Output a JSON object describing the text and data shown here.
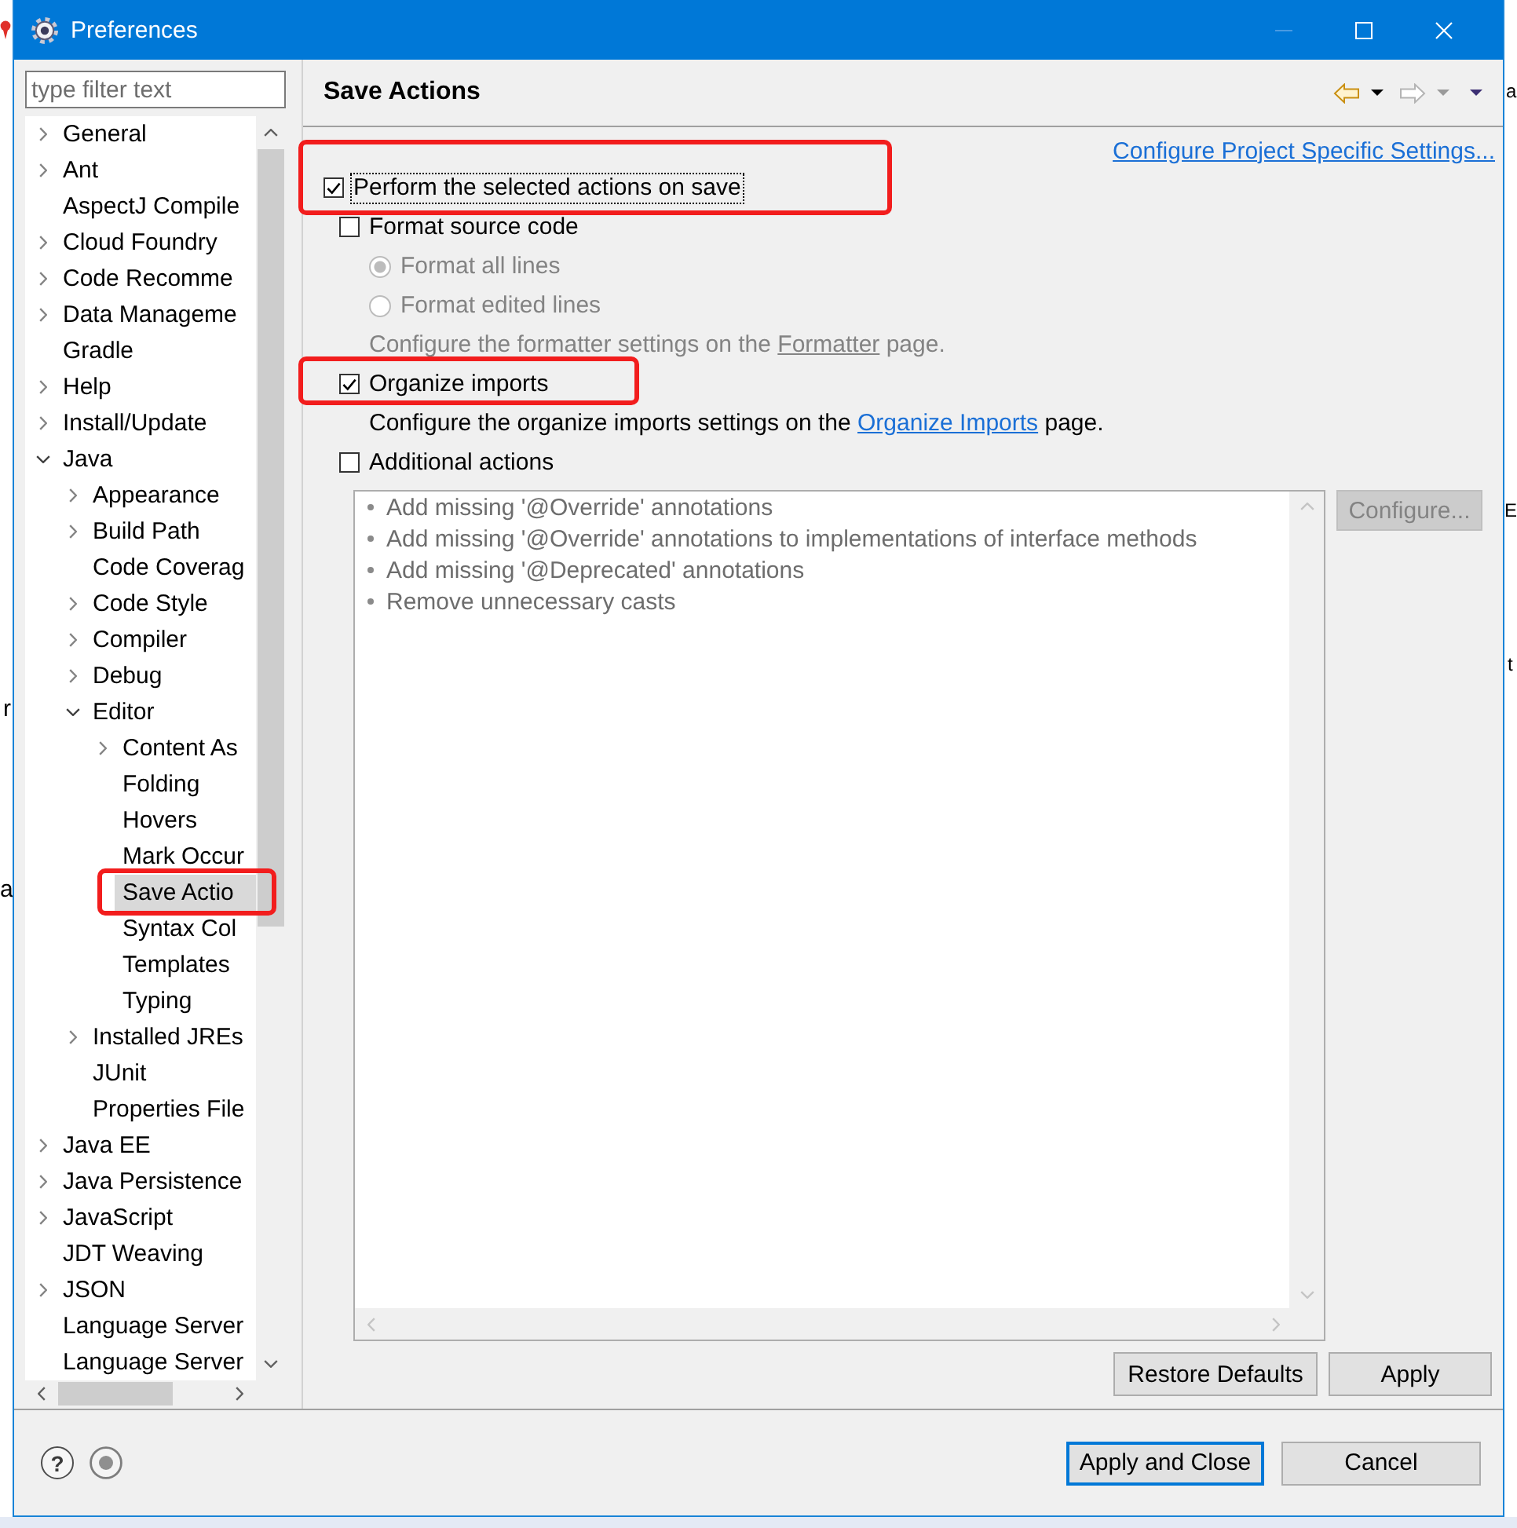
{
  "window": {
    "title": "Preferences",
    "controls": [
      {
        "kind": "minimize",
        "disabled": true
      },
      {
        "kind": "maximize",
        "disabled": false
      },
      {
        "kind": "close",
        "disabled": false
      }
    ]
  },
  "background_window": {
    "left_edge_texts": [
      "r",
      "a"
    ],
    "right_edge_texts": [
      "a",
      "E",
      "t"
    ]
  },
  "filter": {
    "placeholder": "type filter text"
  },
  "tree": [
    {
      "label": "General",
      "kind": "branch",
      "expanded": false,
      "selected": false
    },
    {
      "label": "Ant",
      "kind": "branch",
      "expanded": false,
      "selected": false
    },
    {
      "label": "AspectJ Compile",
      "kind": "leaf",
      "selected": false
    },
    {
      "label": "Cloud Foundry",
      "kind": "branch",
      "expanded": false,
      "selected": false
    },
    {
      "label": "Code Recomme",
      "kind": "branch",
      "expanded": false,
      "selected": false
    },
    {
      "label": "Data Manageme",
      "kind": "branch",
      "expanded": false,
      "selected": false
    },
    {
      "label": "Gradle",
      "kind": "leaf",
      "selected": false
    },
    {
      "label": "Help",
      "kind": "branch",
      "expanded": false,
      "selected": false
    },
    {
      "label": "Install/Update",
      "kind": "branch",
      "expanded": false,
      "selected": false
    },
    {
      "label": "Java",
      "kind": "branch",
      "expanded": true,
      "selected": false,
      "children": [
        {
          "label": "Appearance",
          "kind": "branch",
          "expanded": false,
          "selected": false
        },
        {
          "label": "Build Path",
          "kind": "branch",
          "expanded": false,
          "selected": false
        },
        {
          "label": "Code Coverag",
          "kind": "leaf",
          "selected": false
        },
        {
          "label": "Code Style",
          "kind": "branch",
          "expanded": false,
          "selected": false
        },
        {
          "label": "Compiler",
          "kind": "branch",
          "expanded": false,
          "selected": false
        },
        {
          "label": "Debug",
          "kind": "branch",
          "expanded": false,
          "selected": false
        },
        {
          "label": "Editor",
          "kind": "branch",
          "expanded": true,
          "selected": false,
          "children": [
            {
              "label": "Content As",
              "kind": "branch",
              "expanded": false,
              "selected": false
            },
            {
              "label": "Folding",
              "kind": "leaf",
              "selected": false
            },
            {
              "label": "Hovers",
              "kind": "leaf",
              "selected": false
            },
            {
              "label": "Mark Occur",
              "kind": "leaf",
              "selected": false
            },
            {
              "label": "Save Actio",
              "kind": "leaf",
              "selected": true,
              "highlighted": true
            },
            {
              "label": "Syntax Col",
              "kind": "leaf",
              "selected": false
            },
            {
              "label": "Templates",
              "kind": "leaf",
              "selected": false
            },
            {
              "label": "Typing",
              "kind": "leaf",
              "selected": false
            }
          ]
        },
        {
          "label": "Installed JREs",
          "kind": "branch",
          "expanded": false,
          "selected": false
        },
        {
          "label": "JUnit",
          "kind": "leaf",
          "selected": false
        },
        {
          "label": "Properties File",
          "kind": "leaf",
          "selected": false
        }
      ]
    },
    {
      "label": "Java EE",
      "kind": "branch",
      "expanded": false,
      "selected": false
    },
    {
      "label": "Java Persistence",
      "kind": "branch",
      "expanded": false,
      "selected": false
    },
    {
      "label": "JavaScript",
      "kind": "branch",
      "expanded": false,
      "selected": false
    },
    {
      "label": "JDT Weaving",
      "kind": "leaf",
      "selected": false
    },
    {
      "label": "JSON",
      "kind": "branch",
      "expanded": false,
      "selected": false
    },
    {
      "label": "Language Server",
      "kind": "leaf",
      "selected": false
    },
    {
      "label": "Language Server",
      "kind": "leaf",
      "selected": false
    }
  ],
  "page": {
    "title": "Save Actions",
    "nav": [
      {
        "kind": "back",
        "disabled": false
      },
      {
        "kind": "forward",
        "disabled": true
      }
    ],
    "project_link": "Configure Project Specific Settings...",
    "options": [
      {
        "kind": "checkbox",
        "label": "Perform the selected actions on save",
        "checked": true,
        "focused": true,
        "highlighted": true,
        "children": [
          {
            "kind": "checkbox",
            "label": "Format source code",
            "checked": false,
            "children": [
              {
                "kind": "radio",
                "label": "Format all lines",
                "selected": true,
                "disabled": true
              },
              {
                "kind": "radio",
                "label": "Format edited lines",
                "selected": false,
                "disabled": true
              },
              {
                "kind": "hint",
                "text": "Configure the formatter settings on the ",
                "link": "Formatter",
                "text_after": " page.",
                "disabled": true
              }
            ]
          },
          {
            "kind": "checkbox",
            "label": "Organize imports",
            "checked": true,
            "highlighted": true,
            "children": [
              {
                "kind": "hint",
                "text": "Configure the organize imports settings on the ",
                "link": "Organize Imports",
                "text_after": " page.",
                "disabled": false
              }
            ]
          },
          {
            "kind": "checkbox",
            "label": "Additional actions",
            "checked": false,
            "children": [
              {
                "kind": "list",
                "disabled": true,
                "items": [
                  "Add missing '@Override' annotations",
                  "Add missing '@Override' annotations to implementations of interface methods",
                  "Add missing '@Deprecated' annotations",
                  "Remove unnecessary casts"
                ],
                "button": {
                  "label": "Configure...",
                  "disabled": true
                }
              }
            ]
          }
        ]
      }
    ],
    "buttons": [
      {
        "label": "Restore Defaults"
      },
      {
        "label": "Apply"
      }
    ]
  },
  "footer": {
    "help_glyph": "?",
    "buttons": [
      {
        "label": "Apply and Close",
        "default": true
      },
      {
        "label": "Cancel",
        "default": false
      }
    ]
  }
}
